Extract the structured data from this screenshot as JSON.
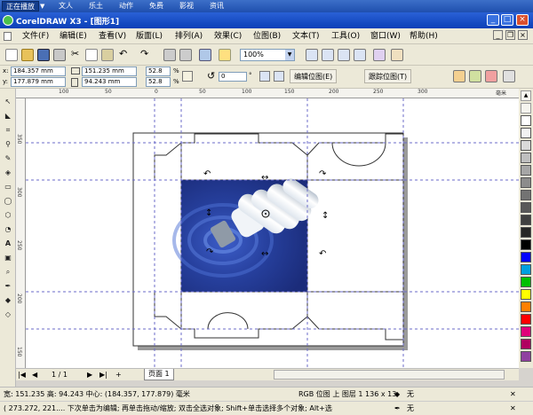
{
  "topband": {
    "buttons": [
      "正在播放",
      "文人",
      "乐土",
      "动作",
      "免费",
      "影视",
      "资讯"
    ]
  },
  "window": {
    "title": "CorelDRAW X3 - [图形1]"
  },
  "menu": [
    "文件(F)",
    "编辑(E)",
    "查看(V)",
    "版面(L)",
    "排列(A)",
    "效果(C)",
    "位图(B)",
    "文本(T)",
    "工具(O)",
    "窗口(W)",
    "帮助(H)"
  ],
  "standard": {
    "zoom": "100%"
  },
  "props": {
    "x": "184.357 mm",
    "y": "177.879 mm",
    "w": "151.235 mm",
    "h": "94.243 mm",
    "sx": "52.8",
    "sy": "52.8",
    "angle": "0",
    "edit_bitmap": "编辑位图(E)",
    "trace_bitmap": "跟踪位图(T)"
  },
  "ruler": {
    "h_ticks": [
      "100",
      "50",
      "0",
      "50",
      "100",
      "150",
      "200",
      "250",
      "300",
      "毫米"
    ],
    "v_ticks": [
      "350",
      "300",
      "250",
      "200",
      "150"
    ]
  },
  "pages": {
    "counter": "1 / 1",
    "tab": "页面 1"
  },
  "status": {
    "line1": "宽: 151.235  高: 94.243  中心: (184.357, 177.879)  毫米",
    "line1_right": "RGB 位图 上 图层 1 136 x 13.",
    "fill": "无",
    "line2": "( 273.272, 221....   下次单击为编辑; 再单击拖动/缩放; 双击全选对象; Shift+单击选择多个对象; Alt+选",
    "outline": "无"
  },
  "palette": [
    "#ffffff",
    "#f2f2f2",
    "#d9d9d9",
    "#bfbfbf",
    "#a6a6a6",
    "#8c8c8c",
    "#737373",
    "#595959",
    "#404040",
    "#262626",
    "#000000",
    "#0000ff",
    "#00a0e0",
    "#00c000",
    "#ffff00",
    "#ff8000",
    "#ff0000",
    "#e0007a",
    "#b00060",
    "#9040a0"
  ]
}
